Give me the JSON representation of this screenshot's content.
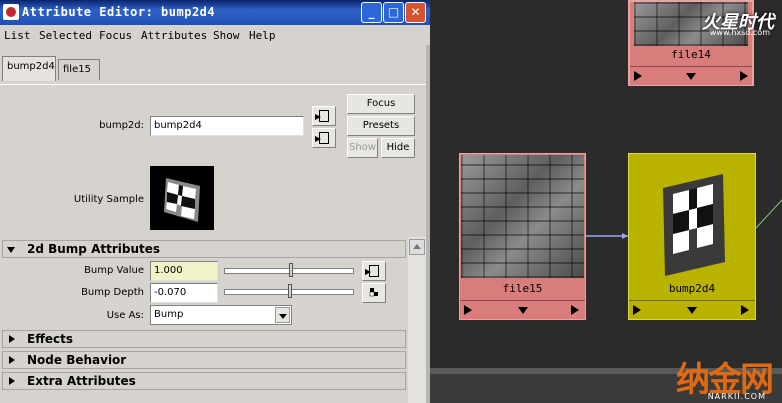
{
  "window": {
    "title": "Attribute Editor: bump2d4",
    "minimize": "_",
    "maximize": "□",
    "close": "✕"
  },
  "menu": [
    "List",
    "Selected",
    "Focus",
    "Attributes",
    "Show",
    "Help"
  ],
  "tabs": [
    {
      "label": "bump2d4",
      "active": true
    },
    {
      "label": "file15",
      "active": false
    }
  ],
  "node": {
    "name_label": "bump2d:",
    "name_value": "bump2d4",
    "sample_label": "Utility Sample"
  },
  "buttons": {
    "focus": "Focus",
    "presets": "Presets",
    "show": "Show",
    "hide": "Hide"
  },
  "sections": {
    "bump": {
      "title": "2d Bump Attributes",
      "bump_value_label": "Bump Value",
      "bump_value": "1.000",
      "bump_depth_label": "Bump Depth",
      "bump_depth": "-0.070",
      "use_as_label": "Use As:",
      "use_as_value": "Bump"
    },
    "effects": "Effects",
    "node_behavior": "Node Behavior",
    "extra": "Extra Attributes"
  },
  "hypershade": {
    "nodes": [
      {
        "name": "file14"
      },
      {
        "name": "file15"
      },
      {
        "name": "bump2d4"
      }
    ],
    "watermark_top": "火星时代",
    "watermark_top_url": "www.hxsd.com",
    "watermark_bottom": "纳金网",
    "watermark_bottom_url": "NARKII.COM"
  },
  "colors": {
    "file_node": "#d97c7c",
    "bump_node": "#b9b300",
    "title_bar": "#0a246a"
  }
}
